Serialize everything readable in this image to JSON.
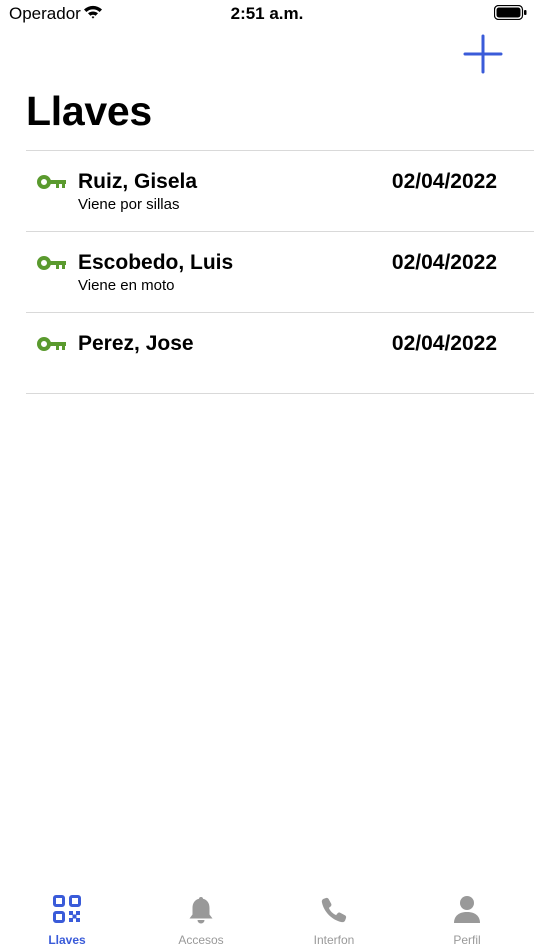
{
  "status_bar": {
    "carrier": "Operador",
    "time": "2:51 a.m."
  },
  "header": {
    "title": "Llaves",
    "add_icon": "plus-icon"
  },
  "keys": [
    {
      "name": "Ruiz, Gisela",
      "note": "Viene por sillas",
      "date": "02/04/2022"
    },
    {
      "name": "Escobedo, Luis",
      "note": "Viene en moto",
      "date": "02/04/2022"
    },
    {
      "name": "Perez, Jose",
      "note": "",
      "date": "02/04/2022"
    }
  ],
  "tabs": [
    {
      "label": "Llaves",
      "icon": "qr-code-icon",
      "active": true
    },
    {
      "label": "Accesos",
      "icon": "bell-icon",
      "active": false
    },
    {
      "label": "Interfon",
      "icon": "phone-icon",
      "active": false
    },
    {
      "label": "Perfil",
      "icon": "person-icon",
      "active": false
    }
  ],
  "colors": {
    "accent": "#3a5bd9",
    "key_green": "#5a9a2e",
    "inactive": "#999999"
  }
}
